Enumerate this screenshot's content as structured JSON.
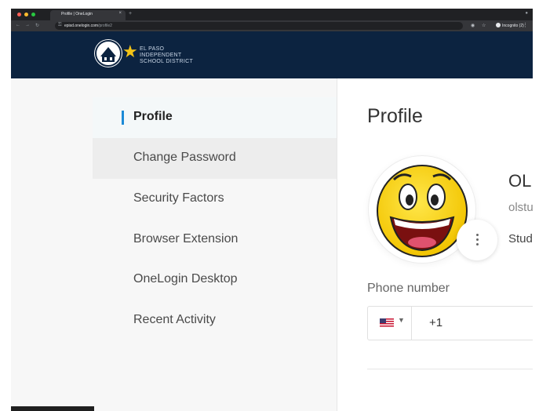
{
  "browser": {
    "tab_title": "Profile | OneLogin",
    "url_host": "episd.onelogin.com",
    "url_path": "/profile2",
    "incognito_label": "Incognito (2)"
  },
  "header": {
    "org_name_lines": [
      "EL PASO",
      "INDEPENDENT",
      "SCHOOL DISTRICT"
    ],
    "brand_colors": {
      "navy": "#0c2340",
      "gold": "#f3c316"
    }
  },
  "sidebar": {
    "items": [
      {
        "label": "Profile",
        "state": "active"
      },
      {
        "label": "Change Password",
        "state": "hover"
      },
      {
        "label": "Security Factors"
      },
      {
        "label": "Browser Extension"
      },
      {
        "label": "OneLogin Desktop"
      },
      {
        "label": "Recent Activity"
      }
    ],
    "accent_color": "#1c8ad6"
  },
  "main": {
    "title": "Profile",
    "user": {
      "name": "OL",
      "login": "olstu",
      "role": "Stud"
    },
    "avatar_icon": "laughing-emoji-icon",
    "phone": {
      "label": "Phone number",
      "country_flag": "us-flag-icon",
      "code": "+1"
    }
  }
}
